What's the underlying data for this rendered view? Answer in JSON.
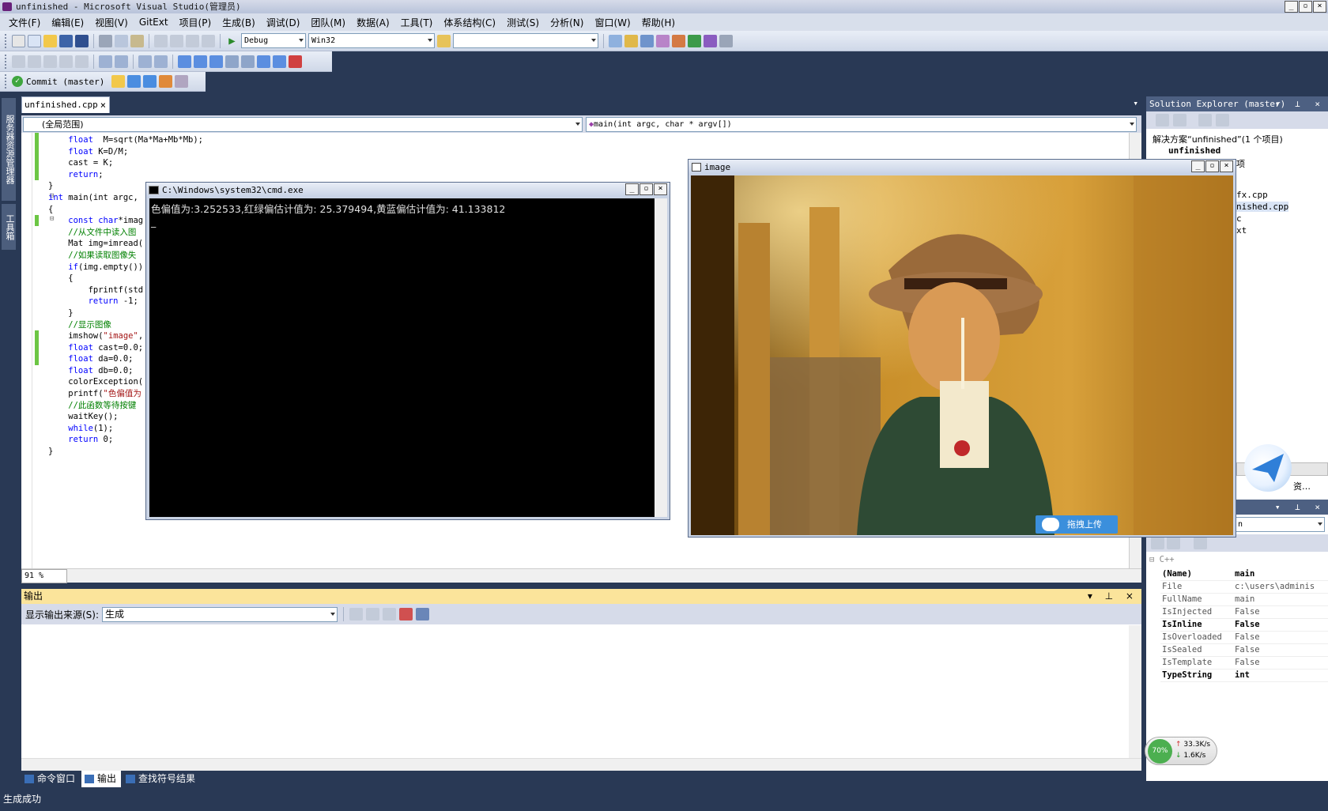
{
  "window": {
    "title": "unfinished - Microsoft Visual Studio(管理员)"
  },
  "menu": [
    "文件(F)",
    "编辑(E)",
    "视图(V)",
    "GitExt",
    "项目(P)",
    "生成(B)",
    "调试(D)",
    "团队(M)",
    "数据(A)",
    "工具(T)",
    "体系结构(C)",
    "测试(S)",
    "分析(N)",
    "窗口(W)",
    "帮助(H)"
  ],
  "toolbar": {
    "config": "Debug",
    "platform": "Win32",
    "find": "",
    "commit": "Commit (master)"
  },
  "left_tabs": [
    "服务器资源管理器",
    "工具箱"
  ],
  "editor": {
    "tab": "unfinished.cpp",
    "scope": "(全局范围)",
    "member": "main(int argc, char * argv[])",
    "zoom": "91 %",
    "lines": [
      [
        [
          "kw",
          "    float"
        ],
        [
          "",
          "  M=sqrt(Ma*Ma+Mb*Mb);"
        ]
      ],
      [
        [
          "kw",
          "    float"
        ],
        [
          "",
          " K=D/M;"
        ]
      ],
      [
        [
          "",
          "    cast = K;"
        ]
      ],
      [
        [
          "kw",
          "    return"
        ],
        [
          "",
          ";"
        ]
      ],
      [
        [
          "",
          "}"
        ]
      ],
      [
        [
          "kw",
          "int"
        ],
        [
          "",
          " main(int argc, "
        ]
      ],
      [
        [
          "",
          "{"
        ]
      ],
      [
        [
          "kw",
          "    const char"
        ],
        [
          "",
          "*imag"
        ]
      ],
      [
        [
          "cm",
          "    //从文件中读入图"
        ]
      ],
      [
        [
          "",
          "    Mat img=imread("
        ]
      ],
      [
        [
          "cm",
          "    //如果读取图像失"
        ]
      ],
      [
        [
          "kw",
          "    if"
        ],
        [
          "",
          "(img.empty())"
        ]
      ],
      [
        [
          "",
          "    {"
        ]
      ],
      [
        [
          "",
          "        fprintf(std"
        ]
      ],
      [
        [
          "kw",
          "        return"
        ],
        [
          "",
          " -1;"
        ]
      ],
      [
        [
          "",
          "    }"
        ]
      ],
      [
        [
          "cm",
          "    //显示图像"
        ]
      ],
      [
        [
          "",
          "    imshow("
        ],
        [
          "st",
          "\"image\""
        ],
        [
          "",
          ","
        ]
      ],
      [
        [
          "kw",
          "    float"
        ],
        [
          "",
          " cast=0.0;"
        ]
      ],
      [
        [
          "kw",
          "    float"
        ],
        [
          "",
          " da=0.0;"
        ]
      ],
      [
        [
          "kw",
          "    float"
        ],
        [
          "",
          " db=0.0;"
        ]
      ],
      [
        [
          "",
          "    colorException("
        ]
      ],
      [
        [
          "",
          "    printf("
        ],
        [
          "st",
          "\"色偏值为"
        ]
      ],
      [
        [
          "cm",
          "    //此函数等待按键"
        ]
      ],
      [
        [
          "",
          "    waitKey();"
        ]
      ],
      [
        [
          "kw",
          "    while"
        ],
        [
          "",
          "(1);"
        ]
      ],
      [
        [
          "kw",
          "    return"
        ],
        [
          "",
          " 0;"
        ]
      ],
      [
        [
          "",
          "}"
        ]
      ]
    ]
  },
  "cmd": {
    "title": "C:\\Windows\\system32\\cmd.exe",
    "line1": "色偏值为:3.252533,红绿偏估计值为: 25.379494,黄蓝偏估计值为: 41.133812",
    "cursor": "_"
  },
  "image_window": {
    "title": "image",
    "upload": "拖拽上传"
  },
  "solution": {
    "title": "Solution Explorer (master)",
    "root": "解决方案“unfinished”(1 个项目)",
    "project": "unfinished",
    "items": [
      "项",
      "fx.cpp",
      "nished.cpp",
      "c",
      "xt"
    ],
    "tab": "资…"
  },
  "properties": {
    "object": "n",
    "section": "C++",
    "rows": [
      {
        "k": "(Name)",
        "v": "main",
        "bold": true
      },
      {
        "k": "File",
        "v": "c:\\users\\adminis",
        "bold": false
      },
      {
        "k": "FullName",
        "v": "main",
        "bold": false
      },
      {
        "k": "IsInjected",
        "v": "False",
        "bold": false
      },
      {
        "k": "IsInline",
        "v": "False",
        "bold": true
      },
      {
        "k": "IsOverloaded",
        "v": "False",
        "bold": false
      },
      {
        "k": "IsSealed",
        "v": "False",
        "bold": false
      },
      {
        "k": "IsTemplate",
        "v": "False",
        "bold": false
      },
      {
        "k": "TypeString",
        "v": "int",
        "bold": true
      }
    ]
  },
  "output": {
    "title": "输出",
    "source_label": "显示输出来源(S):",
    "source": "生成"
  },
  "bottom_tabs": [
    "命令窗口",
    "输出",
    "查找符号结果"
  ],
  "status": "生成成功",
  "network": {
    "pct": "70%",
    "up": "33.3K/s",
    "down": "1.6K/s"
  }
}
